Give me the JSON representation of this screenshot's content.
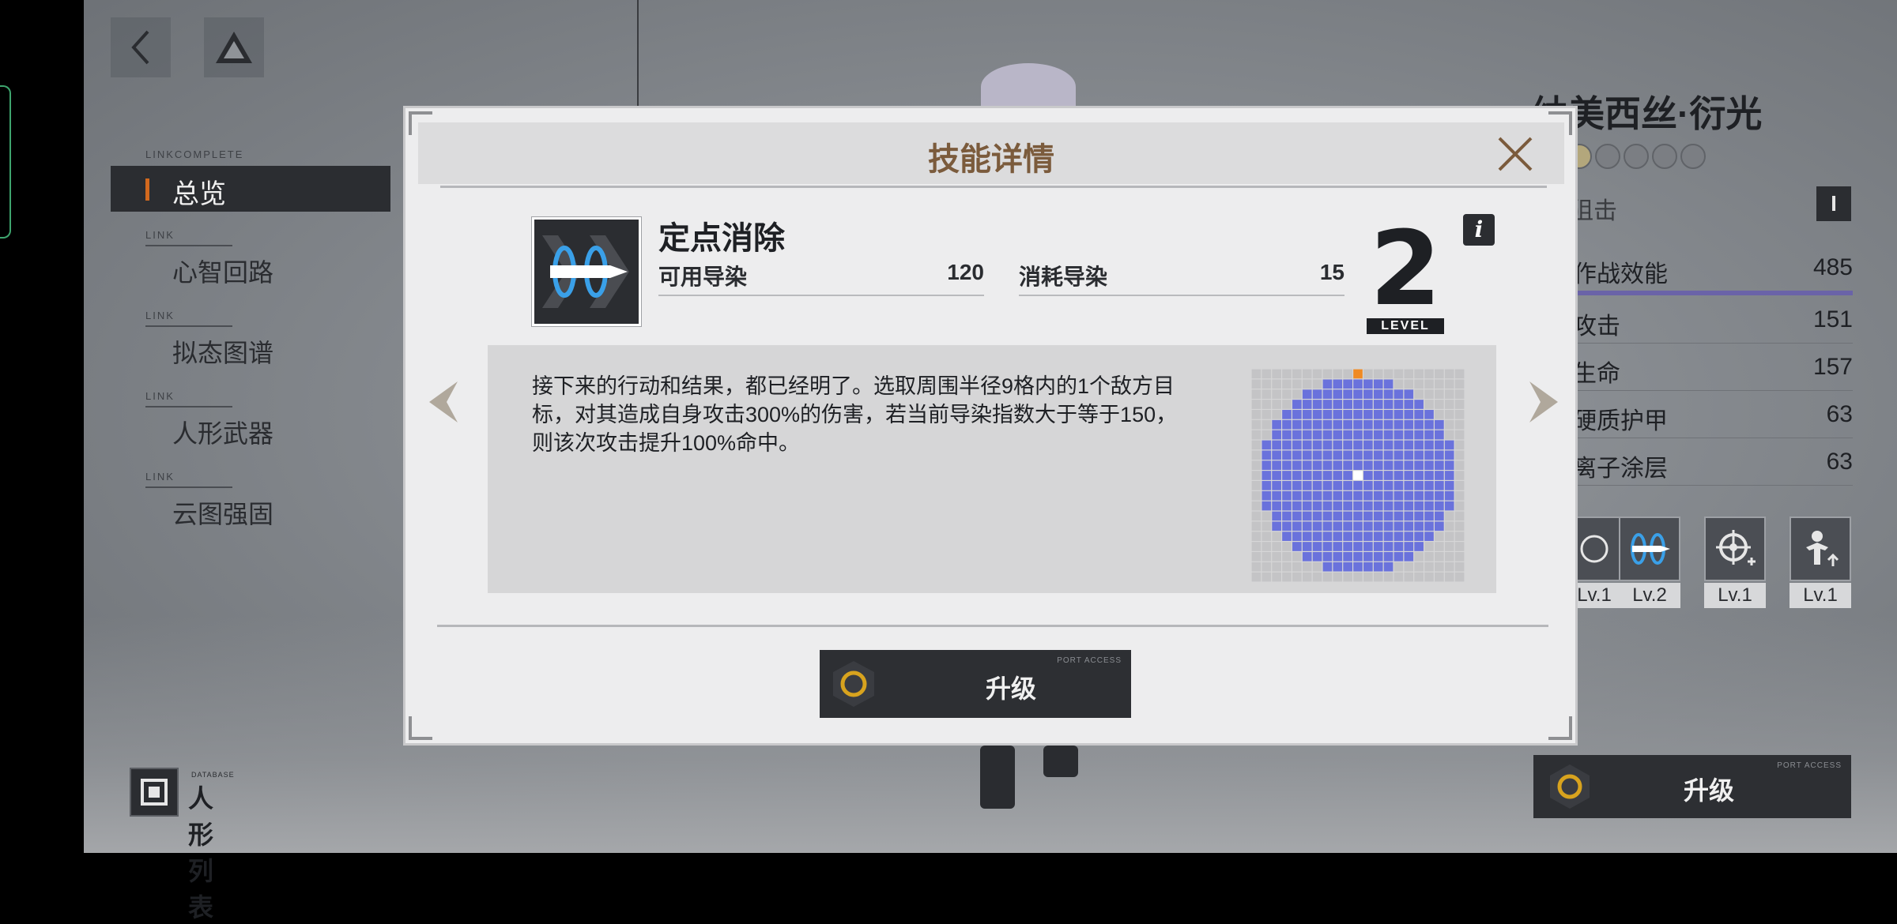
{
  "top_buttons": {
    "back_icon": "chevron-left-icon",
    "home_icon": "triangle-logo-icon"
  },
  "nav": {
    "tag_active": "LINKCOMPLETE",
    "items": [
      {
        "tag": "LINKCOMPLETE",
        "label": "总览"
      },
      {
        "tag": "LINK",
        "label": "心智回路"
      },
      {
        "tag": "LINK",
        "label": "拟态图谱"
      },
      {
        "tag": "LINK",
        "label": "人形武器"
      },
      {
        "tag": "LINK",
        "label": "云图强固"
      }
    ]
  },
  "doll_list": {
    "tag": "DATABASE",
    "label": "人形列表"
  },
  "character": {
    "name": "纳美西丝·衍光",
    "class": "狙击",
    "rank_badge": "I",
    "stats": [
      {
        "name": "作战效能",
        "value": "485"
      },
      {
        "name": "攻击",
        "value": "151"
      },
      {
        "name": "生命",
        "value": "157"
      },
      {
        "name": "硬质护甲",
        "value": "63"
      },
      {
        "name": "离子涂层",
        "value": "63"
      }
    ],
    "skill_levels": [
      "Lv.1",
      "Lv.2",
      "Lv.1",
      "Lv.1"
    ],
    "upgrade_label": "升级",
    "port_access": "PORT ACCESS"
  },
  "modal": {
    "title": "技能详情",
    "skill_name": "定点消除",
    "stat_available_label": "可用导染",
    "stat_available_value": "120",
    "stat_cost_label": "消耗导染",
    "stat_cost_value": "15",
    "level_number": "2",
    "level_label": "LEVEL",
    "info_label": "i",
    "description": "接下来的行动和结果，都已经明了。选取周围半径9格内的1个敌方目标，对其造成自身攻击300%的伤害，若当前导染指数大于等于150，则该次攻击提升100%命中。",
    "upgrade_label": "升级",
    "port_access": "PORT ACCESS",
    "range_radius": 9,
    "colors": {
      "range": "#6a72dc",
      "target": "#f08a24",
      "center": "#ffffff",
      "empty": "#c4c4c6"
    }
  }
}
